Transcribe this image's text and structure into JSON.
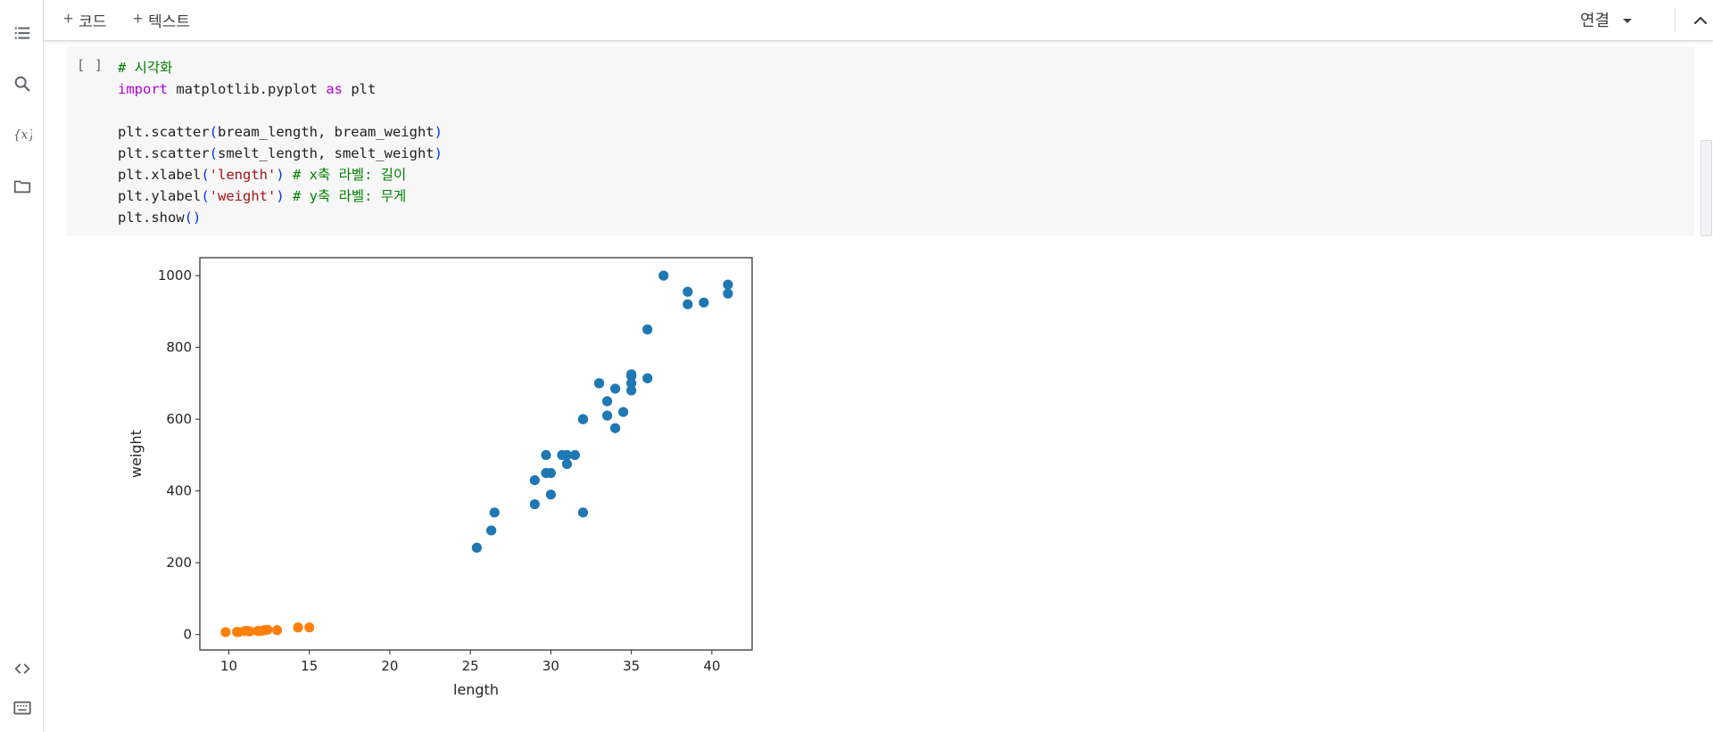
{
  "toolbar": {
    "add_code_label": "코드",
    "add_text_label": "텍스트",
    "connect_label": "연결"
  },
  "cell": {
    "run_indicator": "[ ]",
    "code_lines": [
      [
        {
          "t": "# 시각화",
          "c": "c-com"
        }
      ],
      [
        {
          "t": "import",
          "c": "c-kw"
        },
        {
          "t": " matplotlib.pyplot ",
          "c": ""
        },
        {
          "t": "as",
          "c": "c-kw"
        },
        {
          "t": " plt",
          "c": ""
        }
      ],
      [],
      [
        {
          "t": "plt.scatter",
          "c": ""
        },
        {
          "t": "(",
          "c": "c-paren"
        },
        {
          "t": "bream_length, bream_weight",
          "c": ""
        },
        {
          "t": ")",
          "c": "c-paren"
        }
      ],
      [
        {
          "t": "plt.scatter",
          "c": ""
        },
        {
          "t": "(",
          "c": "c-paren"
        },
        {
          "t": "smelt_length, smelt_weight",
          "c": ""
        },
        {
          "t": ")",
          "c": "c-paren"
        }
      ],
      [
        {
          "t": "plt.xlabel",
          "c": ""
        },
        {
          "t": "(",
          "c": "c-paren"
        },
        {
          "t": "'length'",
          "c": "c-str"
        },
        {
          "t": ")",
          "c": "c-paren"
        },
        {
          "t": " ",
          "c": ""
        },
        {
          "t": "# x축 라벨: 길이",
          "c": "c-com"
        }
      ],
      [
        {
          "t": "plt.ylabel",
          "c": ""
        },
        {
          "t": "(",
          "c": "c-paren"
        },
        {
          "t": "'weight'",
          "c": "c-str"
        },
        {
          "t": ")",
          "c": "c-paren"
        },
        {
          "t": " ",
          "c": ""
        },
        {
          "t": "# y축 라벨: 무게",
          "c": "c-com"
        }
      ],
      [
        {
          "t": "plt.show",
          "c": ""
        },
        {
          "t": "()",
          "c": "c-paren"
        }
      ]
    ]
  },
  "colors": {
    "series_bream": "#1f77b4",
    "series_smelt": "#ff7f0e"
  },
  "chart_data": {
    "type": "scatter",
    "title": "",
    "xlabel": "length",
    "ylabel": "weight",
    "xlim": [
      8.2,
      42.5
    ],
    "ylim": [
      -43,
      1050
    ],
    "xticks": [
      10,
      15,
      20,
      25,
      30,
      35,
      40
    ],
    "yticks": [
      0,
      200,
      400,
      600,
      800,
      1000
    ],
    "grid": false,
    "series": [
      {
        "color": "#1f77b4",
        "points": [
          [
            25.4,
            242
          ],
          [
            26.3,
            290
          ],
          [
            26.5,
            340
          ],
          [
            29.0,
            363
          ],
          [
            29.0,
            430
          ],
          [
            29.7,
            450
          ],
          [
            29.7,
            500
          ],
          [
            30.0,
            390
          ],
          [
            30.0,
            450
          ],
          [
            30.7,
            500
          ],
          [
            31.0,
            475
          ],
          [
            31.0,
            500
          ],
          [
            31.5,
            500
          ],
          [
            32.0,
            340
          ],
          [
            32.0,
            600
          ],
          [
            32.0,
            600
          ],
          [
            33.0,
            700
          ],
          [
            33.0,
            700
          ],
          [
            33.5,
            610
          ],
          [
            33.5,
            650
          ],
          [
            34.0,
            575
          ],
          [
            34.0,
            685
          ],
          [
            34.5,
            620
          ],
          [
            35.0,
            680
          ],
          [
            35.0,
            700
          ],
          [
            35.0,
            725
          ],
          [
            35.0,
            720
          ],
          [
            36.0,
            714
          ],
          [
            36.0,
            850
          ],
          [
            37.0,
            1000
          ],
          [
            38.5,
            920
          ],
          [
            38.5,
            955
          ],
          [
            39.5,
            925
          ],
          [
            41.0,
            975
          ],
          [
            41.0,
            950
          ]
        ]
      },
      {
        "color": "#ff7f0e",
        "points": [
          [
            9.8,
            6.7
          ],
          [
            10.5,
            7.5
          ],
          [
            10.6,
            7.0
          ],
          [
            11.0,
            9.7
          ],
          [
            11.2,
            9.8
          ],
          [
            11.3,
            8.7
          ],
          [
            11.8,
            10.0
          ],
          [
            11.8,
            9.9
          ],
          [
            12.0,
            9.8
          ],
          [
            12.2,
            12.2
          ],
          [
            12.4,
            13.4
          ],
          [
            13.0,
            12.2
          ],
          [
            14.3,
            19.7
          ],
          [
            15.0,
            19.9
          ]
        ]
      }
    ]
  }
}
